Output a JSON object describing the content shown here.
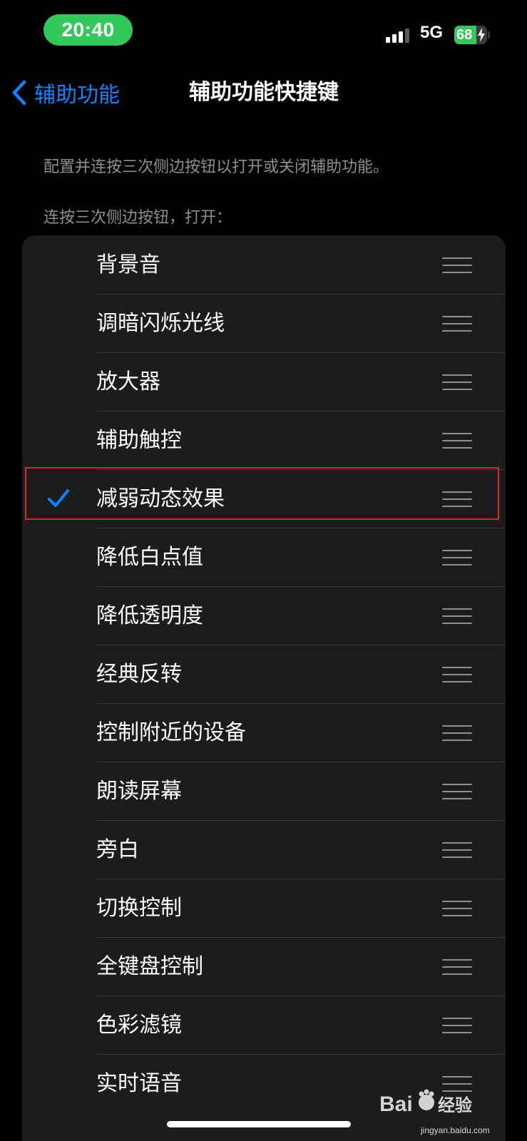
{
  "status_bar": {
    "time": "20:40",
    "network": "5G",
    "battery_percent": "68",
    "battery_level": 0.68,
    "signal_bars_active": 3,
    "signal_bars_total": 4,
    "time_pill_color": "#34c759"
  },
  "nav": {
    "back_label": "辅助功能",
    "title": "辅助功能快捷键",
    "accent_color": "#0a84ff"
  },
  "description": "配置并连按三次侧边按钮以打开或关闭辅助功能。",
  "section_header": "连按三次侧边按钮，打开：",
  "items": [
    {
      "label": "背景音",
      "checked": false
    },
    {
      "label": "调暗闪烁光线",
      "checked": false
    },
    {
      "label": "放大器",
      "checked": false
    },
    {
      "label": "辅助触控",
      "checked": false
    },
    {
      "label": "减弱动态效果",
      "checked": true
    },
    {
      "label": "降低白点值",
      "checked": false
    },
    {
      "label": "降低透明度",
      "checked": false
    },
    {
      "label": "经典反转",
      "checked": false
    },
    {
      "label": "控制附近的设备",
      "checked": false
    },
    {
      "label": "朗读屏幕",
      "checked": false
    },
    {
      "label": "旁白",
      "checked": false
    },
    {
      "label": "切换控制",
      "checked": false
    },
    {
      "label": "全键盘控制",
      "checked": false
    },
    {
      "label": "色彩滤镜",
      "checked": false
    },
    {
      "label": "实时语音",
      "checked": false
    }
  ],
  "highlight_color": "#e0241f",
  "watermark": {
    "brand": "Bai du 经验",
    "url": "jingyan.baidu.com"
  }
}
